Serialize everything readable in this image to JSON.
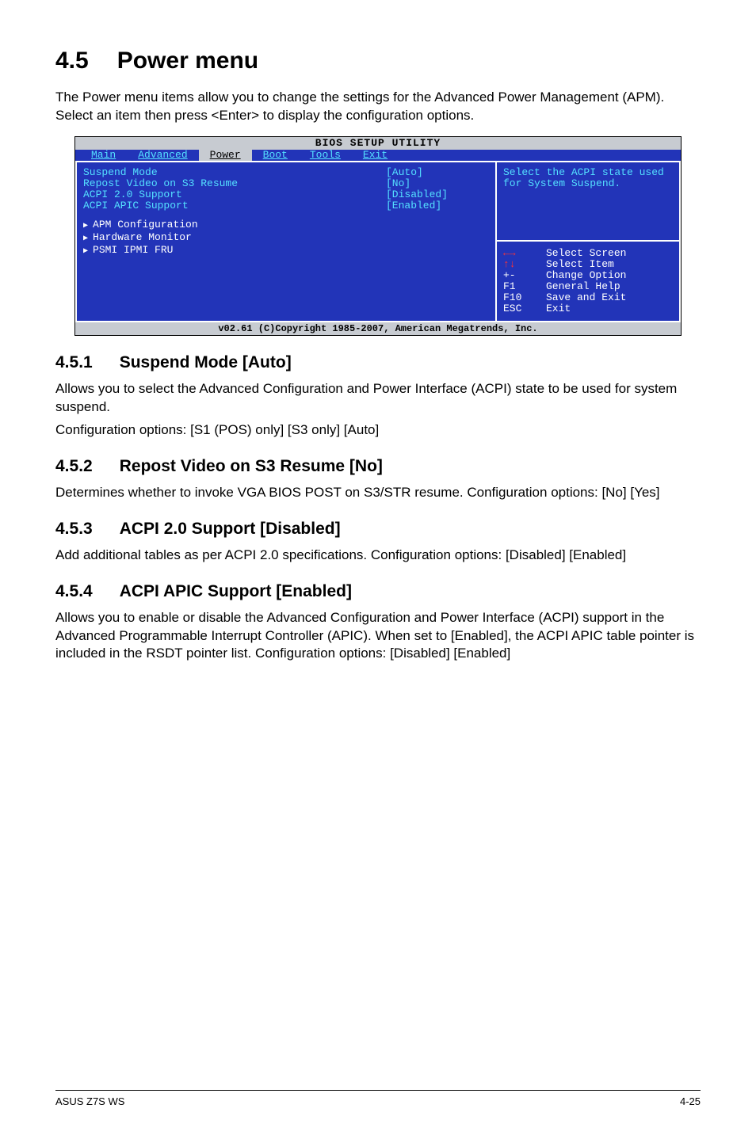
{
  "heading": {
    "number": "4.5",
    "title": "Power menu"
  },
  "intro": "The Power menu items allow you to change the settings for the Advanced Power Management (APM). Select an item then press <Enter> to display the configuration options.",
  "bios": {
    "title": "BIOS SETUP UTILITY",
    "tabs": [
      "Main",
      "Advanced",
      "Power",
      "Boot",
      "Tools",
      "Exit"
    ],
    "active_tab": "Power",
    "rows": [
      {
        "label": "Suspend Mode",
        "value": "[Auto]"
      },
      {
        "label": "Repost Video on S3 Resume",
        "value": "[No]"
      },
      {
        "label": "ACPI 2.0 Support",
        "value": "[Disabled]"
      },
      {
        "label": "ACPI APIC Support",
        "value": "[Enabled]"
      }
    ],
    "submenus": [
      "APM Configuration",
      "Hardware Monitor",
      "PSMI IPMI FRU"
    ],
    "help": "Select the ACPI state used for System Suspend.",
    "keys_header_icons": {
      "h": "←→",
      "v": "↑↓"
    },
    "keys": [
      {
        "k": "←→",
        "d": "Select Screen",
        "icon": true,
        "red": true
      },
      {
        "k": "↑↓",
        "d": "Select Item",
        "icon": true,
        "red": true
      },
      {
        "k": "+-",
        "d": "Change Option"
      },
      {
        "k": "F1",
        "d": "General Help"
      },
      {
        "k": "F10",
        "d": "Save and Exit"
      },
      {
        "k": "ESC",
        "d": "Exit"
      }
    ],
    "footer": "v02.61 (C)Copyright 1985-2007, American Megatrends, Inc."
  },
  "sections": [
    {
      "num": "4.5.1",
      "title": "Suspend Mode [Auto]",
      "paras": [
        "Allows you to select the Advanced Configuration and Power Interface (ACPI) state to be used for system suspend.",
        "Configuration options: [S1 (POS) only] [S3 only] [Auto]"
      ]
    },
    {
      "num": "4.5.2",
      "title": "Repost Video on S3 Resume [No]",
      "paras": [
        "Determines whether to invoke VGA BIOS POST on S3/STR resume. Configuration options: [No] [Yes]"
      ]
    },
    {
      "num": "4.5.3",
      "title": "ACPI 2.0 Support [Disabled]",
      "paras": [
        "Add additional tables as per ACPI 2.0 specifications. Configuration options: [Disabled] [Enabled]"
      ]
    },
    {
      "num": "4.5.4",
      "title": "ACPI APIC Support [Enabled]",
      "paras": [
        "Allows you to enable or disable the Advanced Configuration and Power Interface (ACPI) support in the Advanced Programmable Interrupt Controller (APIC). When set to [Enabled], the ACPI APIC table pointer is included in the RSDT pointer list. Configuration options: [Disabled] [Enabled]"
      ]
    }
  ],
  "footer": {
    "left": "ASUS Z7S WS",
    "right": "4-25"
  }
}
